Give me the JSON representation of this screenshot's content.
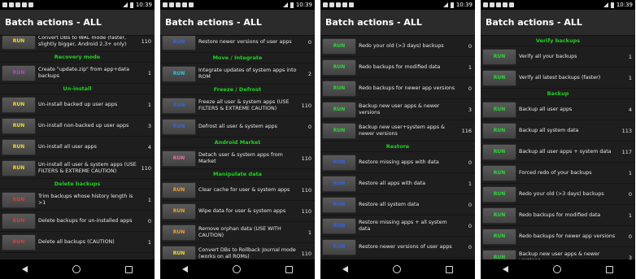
{
  "colors": {
    "yellow": "#f2dd1c",
    "purple": "#c23be8",
    "red": "#e23a3a",
    "cyan": "#27c5d8",
    "pink": "#f06aa6",
    "orange": "#f0a02a",
    "blue": "#3264e8",
    "green": "#2fd43a",
    "section": "#21d121"
  },
  "screens": [
    {
      "time": "10:39",
      "title": "Batch actions - ALL",
      "items": [
        {
          "type": "row",
          "btn": "RUN",
          "color": "yellow",
          "label": "Convert DBs to WAL mode (faster, slightly bigger, Android 2.3+ only)",
          "count": "110"
        },
        {
          "type": "section",
          "label": "Recovery mode"
        },
        {
          "type": "row",
          "btn": "RUN",
          "color": "purple",
          "label": "Create \"update.zip\" from app+data backups",
          "count": "1"
        },
        {
          "type": "section",
          "label": "Un-install"
        },
        {
          "type": "row",
          "btn": "RUN",
          "color": "yellow",
          "label": "Un-install backed up user apps",
          "count": "1"
        },
        {
          "type": "row",
          "btn": "RUN",
          "color": "yellow",
          "label": "Un-install non-backed up user apps",
          "count": "3"
        },
        {
          "type": "row",
          "btn": "RUN",
          "color": "yellow",
          "label": "Un-install all user apps",
          "count": "4"
        },
        {
          "type": "row",
          "btn": "RUN",
          "color": "yellow",
          "label": "Un-install all user & system apps (USE FILTERS & EXTREME CAUTION)",
          "count": "110"
        },
        {
          "type": "section",
          "label": "Delete backups"
        },
        {
          "type": "row",
          "btn": "RUN",
          "color": "red",
          "label": "Trim backups whose history length is >1",
          "count": "1"
        },
        {
          "type": "row",
          "btn": "RUN",
          "color": "red",
          "label": "Delete backups for un-installed apps",
          "count": "0"
        },
        {
          "type": "row",
          "btn": "RUN",
          "color": "red",
          "label": "Delete all backups (CAUTION)",
          "count": "1"
        }
      ]
    },
    {
      "time": "10:39",
      "title": "Batch actions - ALL",
      "items": [
        {
          "type": "row",
          "btn": "RUN",
          "color": "blue",
          "label": "Restore newer versions of user apps",
          "count": "0"
        },
        {
          "type": "section",
          "label": "Move / Integrate"
        },
        {
          "type": "row",
          "btn": "RUN",
          "color": "cyan",
          "label": "Integrate updates of system apps into ROM",
          "count": "2"
        },
        {
          "type": "section",
          "label": "Freeze / Defrost"
        },
        {
          "type": "row",
          "btn": "RUN",
          "color": "blue",
          "label": "Freeze all user & system apps (USE FILTERS & EXTREME CAUTION)",
          "count": "110"
        },
        {
          "type": "row",
          "btn": "RUN",
          "color": "blue",
          "label": "Defrost all user & system apps",
          "count": "0"
        },
        {
          "type": "section",
          "label": "Android Market"
        },
        {
          "type": "row",
          "btn": "RUN",
          "color": "pink",
          "label": "Detach user & system apps from Market",
          "count": "110"
        },
        {
          "type": "section",
          "label": "Manipulate data"
        },
        {
          "type": "row",
          "btn": "RUN",
          "color": "orange",
          "label": "Clear cache for user & system apps",
          "count": "110"
        },
        {
          "type": "row",
          "btn": "RUN",
          "color": "orange",
          "label": "Wipe data for user & system apps",
          "count": "110"
        },
        {
          "type": "row",
          "btn": "RUN",
          "color": "orange",
          "label": "Remove orphan data (USE WITH CAUTION)",
          "count": "1"
        },
        {
          "type": "row",
          "btn": "RUN",
          "color": "yellow",
          "label": "Convert DBs to Rollback Journal mode (works on all ROMs)",
          "count": "110"
        }
      ]
    },
    {
      "time": "10:39",
      "title": "Batch actions - ALL",
      "items": [
        {
          "type": "row",
          "btn": "RUN",
          "color": "green",
          "label": "Redo your old (>3 days) backups",
          "count": "0"
        },
        {
          "type": "row",
          "btn": "RUN",
          "color": "green",
          "label": "Redo backups for modified data",
          "count": "1"
        },
        {
          "type": "row",
          "btn": "RUN",
          "color": "green",
          "label": "Redo backups for newer app versions",
          "count": "0"
        },
        {
          "type": "row",
          "btn": "RUN",
          "color": "green",
          "label": "Backup new user apps & newer versions",
          "count": "3"
        },
        {
          "type": "row",
          "btn": "RUN",
          "color": "green",
          "label": "Backup new user+system apps & newer versions",
          "count": "116"
        },
        {
          "type": "section",
          "label": "Restore"
        },
        {
          "type": "row",
          "btn": "RUN",
          "color": "blue",
          "label": "Restore missing apps with data",
          "count": "0"
        },
        {
          "type": "row",
          "btn": "RUN",
          "color": "blue",
          "label": "Restore all apps with data",
          "count": "1"
        },
        {
          "type": "row",
          "btn": "RUN",
          "color": "blue",
          "label": "Restore all system data",
          "count": "0"
        },
        {
          "type": "row",
          "btn": "RUN",
          "color": "blue",
          "label": "Restore missing apps + all system data",
          "count": "0"
        },
        {
          "type": "row",
          "btn": "RUN",
          "color": "blue",
          "label": "Restore newer versions of user apps",
          "count": "0"
        }
      ]
    },
    {
      "time": "10:39",
      "title": "Batch actions - ALL",
      "items": [
        {
          "type": "section",
          "label": "Verify backups"
        },
        {
          "type": "row",
          "btn": "RUN",
          "color": "green",
          "label": "Verify all your backups",
          "count": "1"
        },
        {
          "type": "row",
          "btn": "RUN",
          "color": "green",
          "label": "Verify all latest backups (faster)",
          "count": "1"
        },
        {
          "type": "section",
          "label": "Backup"
        },
        {
          "type": "row",
          "btn": "RUN",
          "color": "green",
          "label": "Backup all user apps",
          "count": "4"
        },
        {
          "type": "row",
          "btn": "RUN",
          "color": "green",
          "label": "Backup all system data",
          "count": "113"
        },
        {
          "type": "row",
          "btn": "RUN",
          "color": "green",
          "label": "Backup all user apps + system data",
          "count": "117"
        },
        {
          "type": "row",
          "btn": "RUN",
          "color": "green",
          "label": "Forced redo of your backups",
          "count": "1"
        },
        {
          "type": "row",
          "btn": "RUN",
          "color": "green",
          "label": "Redo your old (>3 days) backups",
          "count": "0"
        },
        {
          "type": "row",
          "btn": "RUN",
          "color": "green",
          "label": "Redo backups for modified data",
          "count": "1"
        },
        {
          "type": "row",
          "btn": "RUN",
          "color": "green",
          "label": "Redo backups for newer app versions",
          "count": "0"
        },
        {
          "type": "row",
          "btn": "RUN",
          "color": "green",
          "label": "Backup new user apps & newer versions",
          "count": "3"
        }
      ]
    }
  ]
}
